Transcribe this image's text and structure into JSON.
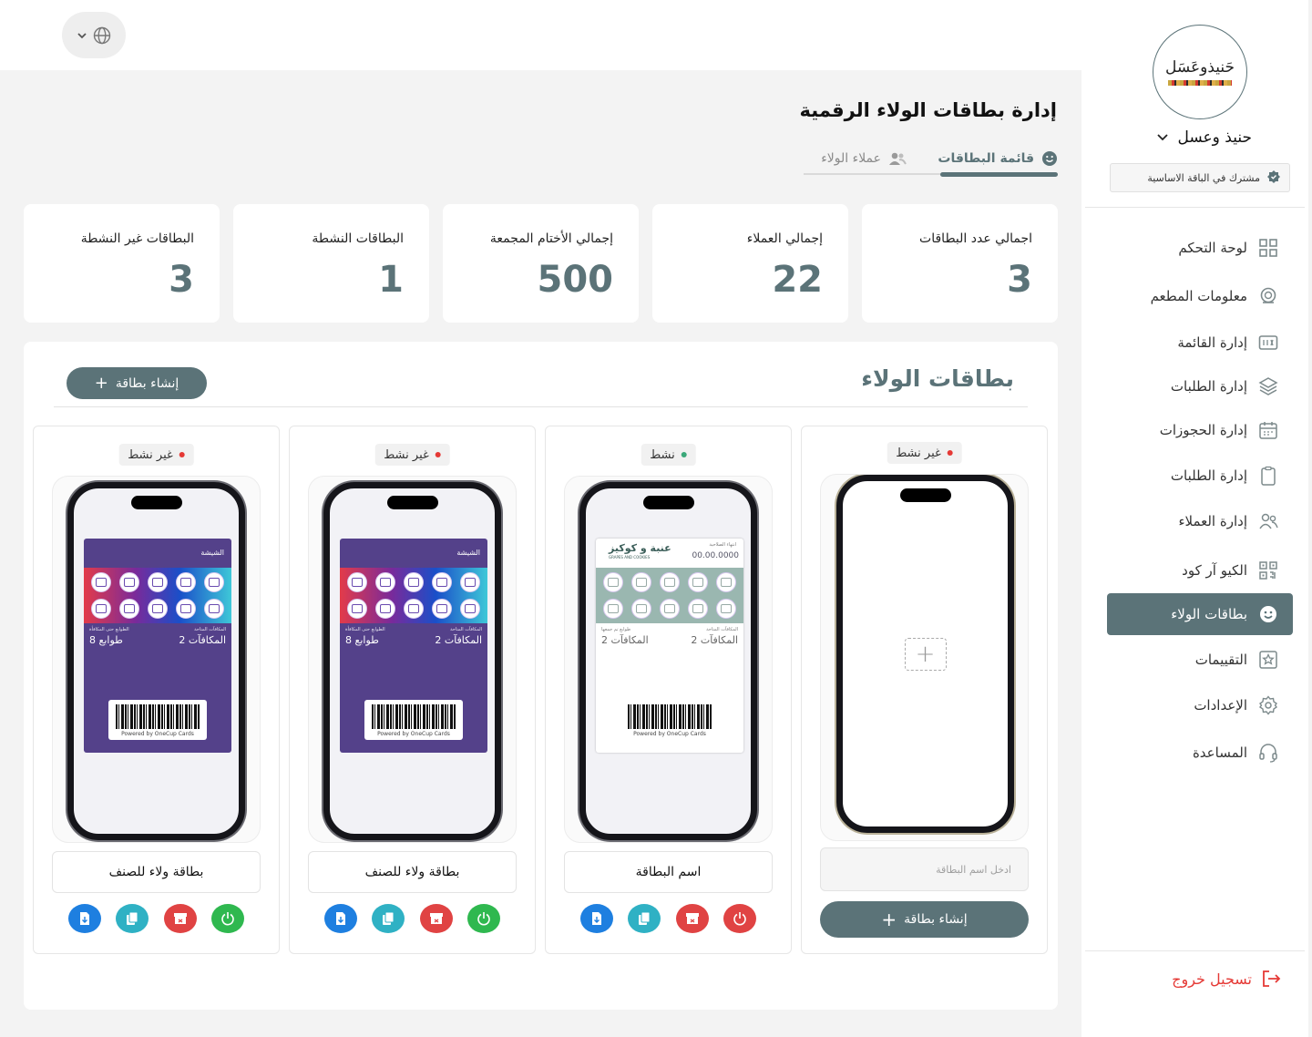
{
  "header": {
    "language_icon": "globe-icon"
  },
  "page": {
    "title": "إدارة بطاقات الولاء الرقمية",
    "tabs": [
      {
        "label": "قائمة البطاقات",
        "icon": "smile-icon",
        "active": true
      },
      {
        "label": "عملاء الولاء",
        "icon": "users-icon",
        "active": false
      }
    ]
  },
  "stats": [
    {
      "label": "اجمالي عدد البطاقات",
      "value": "3"
    },
    {
      "label": "إجمالي العملاء",
      "value": "22"
    },
    {
      "label": "إجمالي الأختام المجمعة",
      "value": "500"
    },
    {
      "label": "البطاقات النشطة",
      "value": "1"
    },
    {
      "label": "البطاقات غير النشطة",
      "value": "3"
    }
  ],
  "cards_panel": {
    "title": "بطاقات الولاء",
    "create_button": "إنشاء بطاقة",
    "new_card": {
      "status": "غير نشط",
      "name_placeholder": "ادخل اسم البطاقة",
      "create_button": "إنشاء بطاقة"
    },
    "cards": [
      {
        "status": "نشط",
        "status_color": "#3aa879",
        "name": "اسم البطاقة",
        "pass": {
          "brand": "عنبة و كوكيز",
          "brand_sub": "GRAPES AND COOKIES",
          "expiry_label": "انتهاء الصلاحية",
          "expiry_value": "00.00.0000",
          "left_small": "طوابع تم جمعها",
          "left_value": "المكافآت 2",
          "right_small": "المكافآت المتاحة",
          "right_value": "المكافآت 2",
          "powered": "Powered by OneCup Cards"
        },
        "actions": [
          "download-icon",
          "copy-icon",
          "archive-icon",
          "power-icon"
        ],
        "power_color": "#e04343"
      },
      {
        "status": "غير نشط",
        "status_color": "#e53935",
        "name": "بطاقة ولاء للصنف",
        "pass": {
          "title": "الشيشة",
          "left_small": "الطوابع حتى المكافأة",
          "left_value": "طوابع 8",
          "right_small": "المكافآت المتاحة",
          "right_value": "المكافآت 2",
          "powered": "Powered by OneCup Cards"
        },
        "actions": [
          "download-icon",
          "copy-icon",
          "archive-icon",
          "power-icon"
        ],
        "power_color": "#2fb84f"
      },
      {
        "status": "غير نشط",
        "status_color": "#e53935",
        "name": "بطاقة ولاء للصنف",
        "pass": {
          "title": "الشيشة",
          "left_small": "الطوابع حتى المكافأة",
          "left_value": "طوابع 8",
          "right_small": "المكافآت المتاحة",
          "right_value": "المكافآت 2",
          "powered": "Powered by OneCup Cards"
        },
        "actions": [
          "download-icon",
          "copy-icon",
          "archive-icon",
          "power-icon"
        ],
        "power_color": "#2fb84f"
      }
    ]
  },
  "sidebar": {
    "logo_text": "حَنيذوعَسَل",
    "restaurant_name": "حنيذ وعسل",
    "plan": "مشترك في الباقة الاساسية",
    "items": [
      {
        "label": "لوحة التحكم",
        "icon": "dashboard-icon"
      },
      {
        "label": "معلومات المطعم",
        "icon": "restaurant-icon"
      },
      {
        "label": "إدارة القائمة",
        "icon": "menu-icon"
      },
      {
        "label": "إدارة الطلبات",
        "icon": "layers-icon"
      },
      {
        "label": "إدارة الحجوزات",
        "icon": "calendar-icon"
      },
      {
        "label": "إدارة الطلبات",
        "icon": "clipboard-icon"
      },
      {
        "label": "إدارة العملاء",
        "icon": "users-icon"
      },
      {
        "label": "الكيو آر كود",
        "icon": "qr-code-icon"
      },
      {
        "label": "بطاقات الولاء",
        "icon": "smile-icon",
        "active": true
      },
      {
        "label": "التقييمات",
        "icon": "star-icon"
      },
      {
        "label": "الإعدادات",
        "icon": "gear-icon"
      },
      {
        "label": "المساعدة",
        "icon": "headset-icon"
      }
    ],
    "logout": "تسجيل خروج"
  },
  "colors": {
    "primary": "#5b7378",
    "danger": "#e53935",
    "success": "#3aa879"
  }
}
